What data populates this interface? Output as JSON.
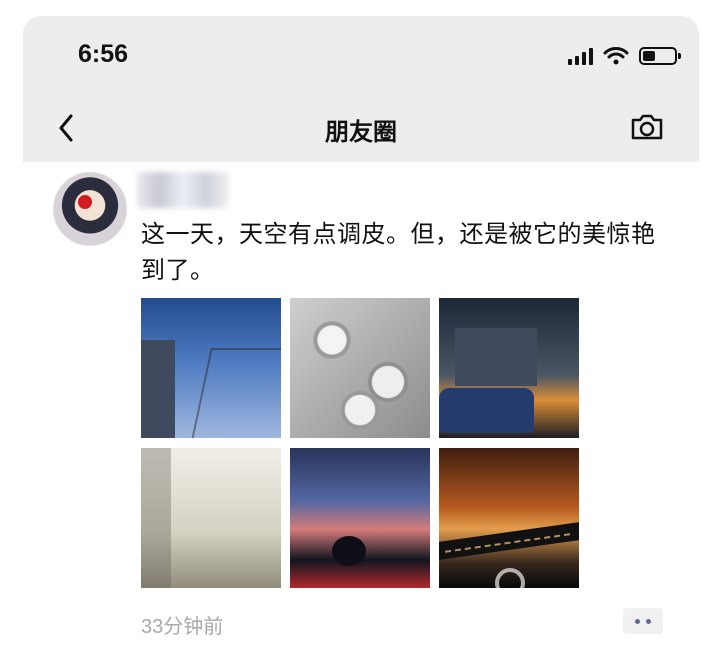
{
  "status_bar": {
    "time": "6:56",
    "icons": [
      "signal-icon",
      "wifi-icon",
      "battery-icon"
    ],
    "battery_level": 0.3
  },
  "nav_bar": {
    "title": "朋友圈",
    "left_icon": "chevron-left-icon",
    "right_icon": "camera-icon"
  },
  "post": {
    "avatar_icon": "avatar",
    "username": "",
    "text": "这一天，天空有点调皮。但，还是被它的美惊艳到了。",
    "images": [
      {
        "name": "photo-blue-sky-trees"
      },
      {
        "name": "photo-hailstones"
      },
      {
        "name": "photo-sunset-street"
      },
      {
        "name": "photo-pale-sky-rainbow"
      },
      {
        "name": "photo-dusk-clouds"
      },
      {
        "name": "photo-orange-sky-bridge"
      }
    ],
    "timestamp": "33分钟前",
    "more_icon": "more-icon"
  },
  "colors": {
    "header_bg": "#ededed",
    "text": "#111111",
    "muted": "#a9a9a9",
    "wechat_link": "#5d6b92"
  }
}
